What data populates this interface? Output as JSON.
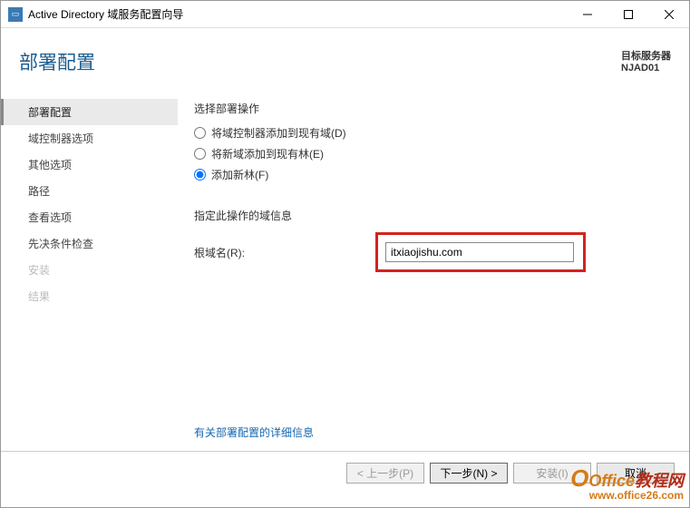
{
  "window": {
    "title": "Active Directory 域服务配置向导"
  },
  "header": {
    "title": "部署配置",
    "target_label": "目标服务器",
    "target_name": "NJAD01"
  },
  "sidebar": {
    "items": [
      {
        "label": "部署配置",
        "state": "active"
      },
      {
        "label": "域控制器选项",
        "state": "normal"
      },
      {
        "label": "其他选项",
        "state": "normal"
      },
      {
        "label": "路径",
        "state": "normal"
      },
      {
        "label": "查看选项",
        "state": "normal"
      },
      {
        "label": "先决条件检查",
        "state": "normal"
      },
      {
        "label": "安装",
        "state": "disabled"
      },
      {
        "label": "结果",
        "state": "disabled"
      }
    ]
  },
  "main": {
    "select_op_label": "选择部署操作",
    "options": [
      {
        "label": "将域控制器添加到现有域(D)",
        "checked": false
      },
      {
        "label": "将新域添加到现有林(E)",
        "checked": false
      },
      {
        "label": "添加新林(F)",
        "checked": true
      }
    ],
    "domain_info_label": "指定此操作的域信息",
    "root_domain_label": "根域名(R):",
    "root_domain_value": "itxiaojishu.com",
    "more_link": "有关部署配置的详细信息"
  },
  "footer": {
    "prev": "< 上一步(P)",
    "next": "下一步(N) >",
    "install": "安装(I)",
    "cancel": "取消"
  },
  "watermark": {
    "brand1": "Office",
    "brand2": "教程网",
    "url": "www.office26.com"
  }
}
